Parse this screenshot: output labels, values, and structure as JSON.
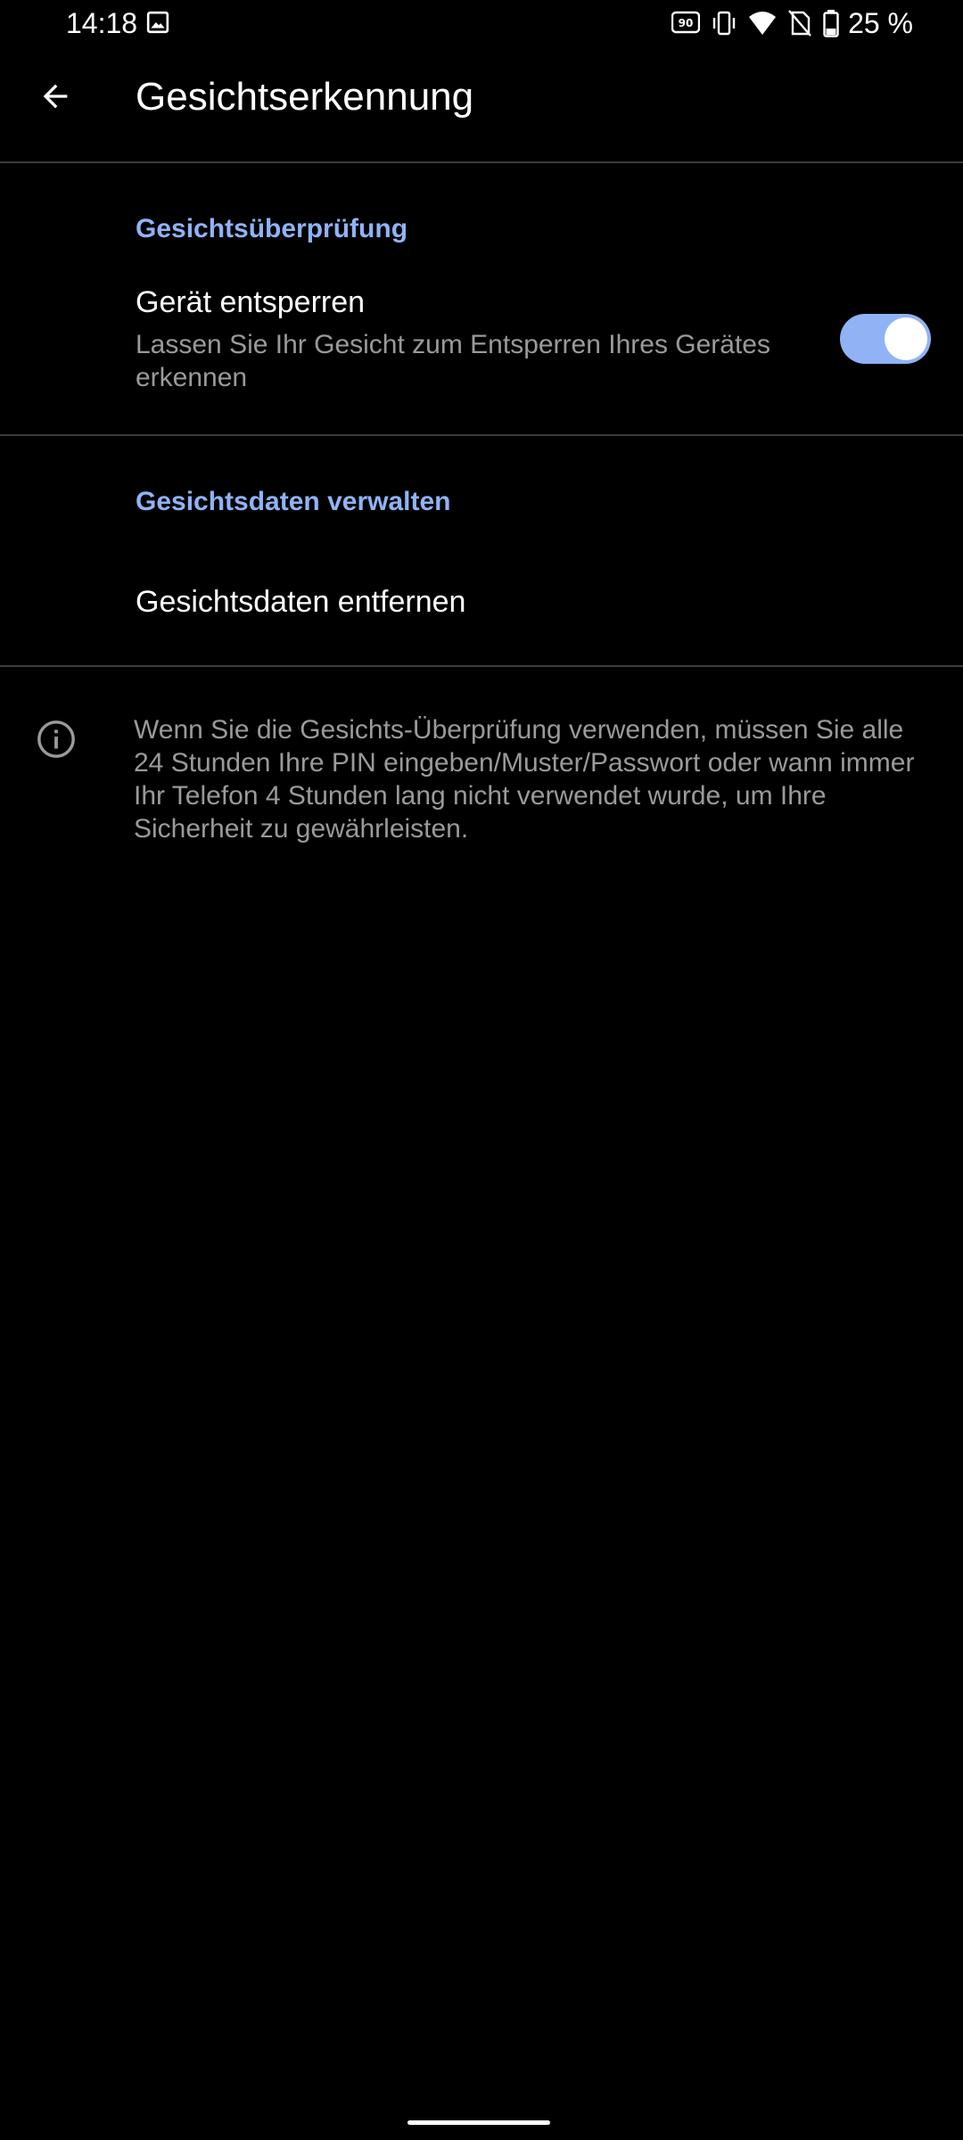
{
  "status_bar": {
    "time": "14:18",
    "battery_percent": "25 %",
    "icons": [
      "image-icon",
      "refresh-rate-90hz-icon",
      "vibrate-icon",
      "wifi-icon",
      "no-sim-icon",
      "battery-icon"
    ]
  },
  "app_bar": {
    "title": "Gesichtserkennung",
    "back_icon": "arrow-back-icon"
  },
  "sections": {
    "verification": {
      "header": "Gesichtsüberprüfung",
      "unlock": {
        "title": "Gerät entsperren",
        "summary": "Lassen Sie Ihr Gesicht zum Entsperren Ihres Gerätes erkennen",
        "enabled": true
      }
    },
    "manage": {
      "header": "Gesichtsdaten verwalten",
      "remove": {
        "title": "Gesichtsdaten entfernen"
      }
    }
  },
  "info": {
    "icon": "info-icon",
    "text": "Wenn Sie die Gesichts-Überprüfung verwenden, müssen Sie alle 24 Stunden Ihre PIN eingeben/Muster/Passwort oder wann immer Ihr Telefon 4 Stunden lang nicht verwendet wurde, um Ihre Sicherheit zu gewährleisten."
  },
  "colors": {
    "background": "#000000",
    "accent": "#8fb3f5",
    "secondary_text": "#9a9a9a",
    "divider": "#3a3a3a"
  }
}
